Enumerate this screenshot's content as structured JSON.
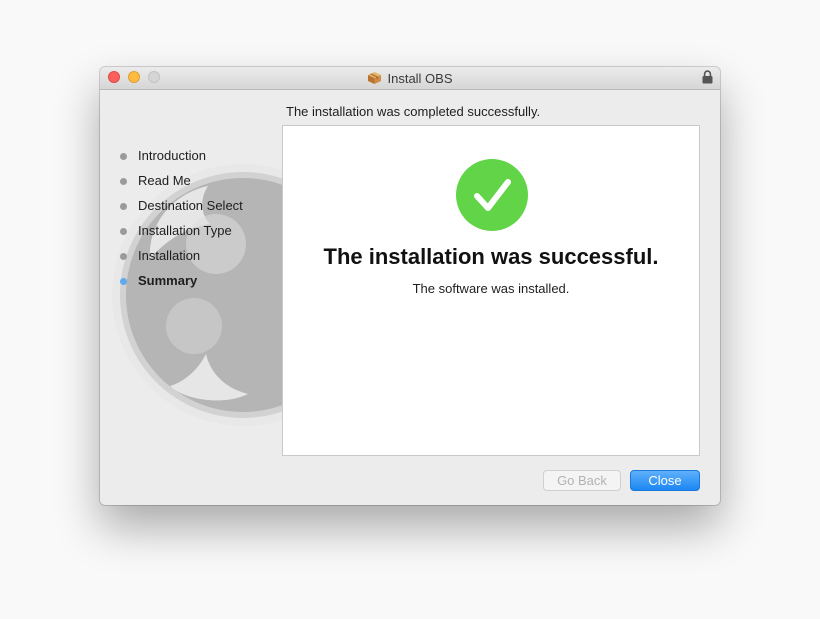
{
  "window": {
    "title": "Install OBS",
    "title_icon": "package-icon",
    "lock_icon": "lock-icon"
  },
  "sidebar": {
    "steps": [
      {
        "label": "Introduction",
        "state": "done"
      },
      {
        "label": "Read Me",
        "state": "done"
      },
      {
        "label": "Destination Select",
        "state": "done"
      },
      {
        "label": "Installation Type",
        "state": "done"
      },
      {
        "label": "Installation",
        "state": "done"
      },
      {
        "label": "Summary",
        "state": "current"
      }
    ],
    "background_logo": "obs-logo-icon"
  },
  "main": {
    "header": "The installation was completed successfully.",
    "status_icon": "checkmark-icon",
    "title": "The installation was successful.",
    "subtitle": "The software was installed."
  },
  "buttons": {
    "back_label": "Go Back",
    "back_enabled": false,
    "close_label": "Close"
  },
  "colors": {
    "accent": "#1c87f2",
    "success": "#62d448",
    "current_step_dot": "#5fa9ef"
  }
}
